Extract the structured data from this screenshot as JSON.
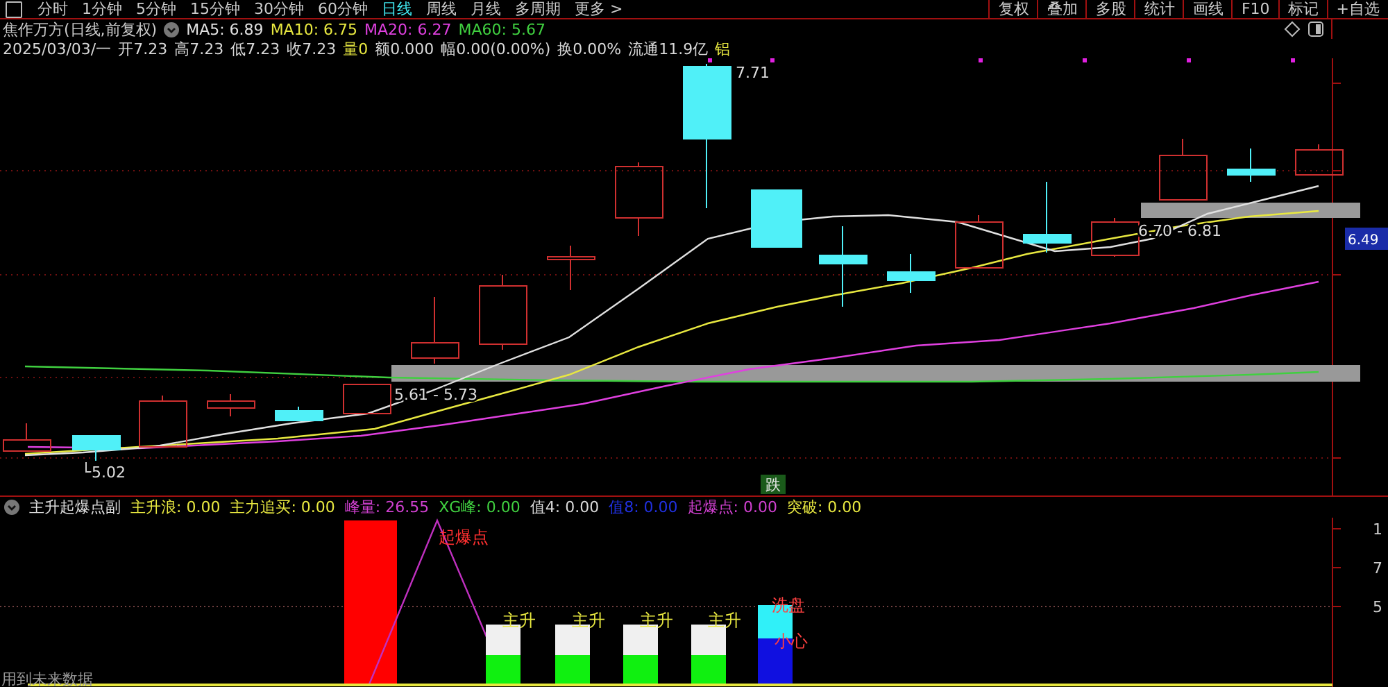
{
  "toolbar": {
    "periods": [
      {
        "label": "分时",
        "selected": false
      },
      {
        "label": "1分钟",
        "selected": false
      },
      {
        "label": "5分钟",
        "selected": false
      },
      {
        "label": "15分钟",
        "selected": false
      },
      {
        "label": "30分钟",
        "selected": false
      },
      {
        "label": "60分钟",
        "selected": false
      },
      {
        "label": "日线",
        "selected": true
      },
      {
        "label": "周线",
        "selected": false
      },
      {
        "label": "月线",
        "selected": false
      },
      {
        "label": "多周期",
        "selected": false
      },
      {
        "label": "更多 >",
        "selected": false
      }
    ],
    "buttons": [
      "复权",
      "叠加",
      "多股",
      "统计",
      "画线",
      "F10",
      "标记",
      "+自选"
    ]
  },
  "chart_header": {
    "title": "焦作万方(日线,前复权)",
    "ma": [
      {
        "label": "MA5: 6.89",
        "color": "#e0e0e0"
      },
      {
        "label": "MA10: 6.75",
        "color": "#e8e840"
      },
      {
        "label": "MA20: 6.27",
        "color": "#e040e0"
      },
      {
        "label": "MA60: 5.67",
        "color": "#40d040"
      }
    ],
    "quote": [
      {
        "text": "2025/03/03/一",
        "color": "#d8d8d8"
      },
      {
        "text": "开7.23",
        "color": "#d8d8d8"
      },
      {
        "text": "高7.23",
        "color": "#d8d8d8"
      },
      {
        "text": "低7.23",
        "color": "#d8d8d8"
      },
      {
        "text": "收7.23",
        "color": "#d8d8d8"
      },
      {
        "text": "量0",
        "color": "#e8e840"
      },
      {
        "text": "额0.000",
        "color": "#d8d8d8"
      },
      {
        "text": "幅0.00(0.00%)",
        "color": "#d8d8d8"
      },
      {
        "text": "换0.00%",
        "color": "#d8d8d8"
      },
      {
        "text": "流通11.9亿",
        "color": "#d8d8d8"
      },
      {
        "text": "铝",
        "color": "#e8e840"
      }
    ]
  },
  "price_chart": {
    "annotations": [
      "7.71",
      "5.02",
      "5.61 - 5.73",
      "6.70 - 6.81"
    ],
    "signal": "跌",
    "current_price": "6.49"
  },
  "indicator": {
    "title": "主升起爆点副",
    "values": [
      {
        "label": "主升浪: 0.00",
        "color": "#e8e840"
      },
      {
        "label": "主力追买: 0.00",
        "color": "#e8e840"
      },
      {
        "label": "峰量: 26.55",
        "color": "#d040d0"
      },
      {
        "label": "XG峰: 0.00",
        "color": "#40d040"
      },
      {
        "label": "值4: 0.00",
        "color": "#d8d8d8"
      },
      {
        "label": "值8: 0.00",
        "color": "#2030e0"
      },
      {
        "label": "起爆点: 0.00",
        "color": "#d040d0"
      },
      {
        "label": "突破: 0.00",
        "color": "#e8e840"
      }
    ],
    "bar_labels": [
      "起爆点",
      "主升",
      "主升",
      "主升",
      "主升",
      "洗盘",
      "小心"
    ],
    "axis_labels": [
      "1",
      "7",
      "5"
    ],
    "note": "用到未来数据"
  }
}
